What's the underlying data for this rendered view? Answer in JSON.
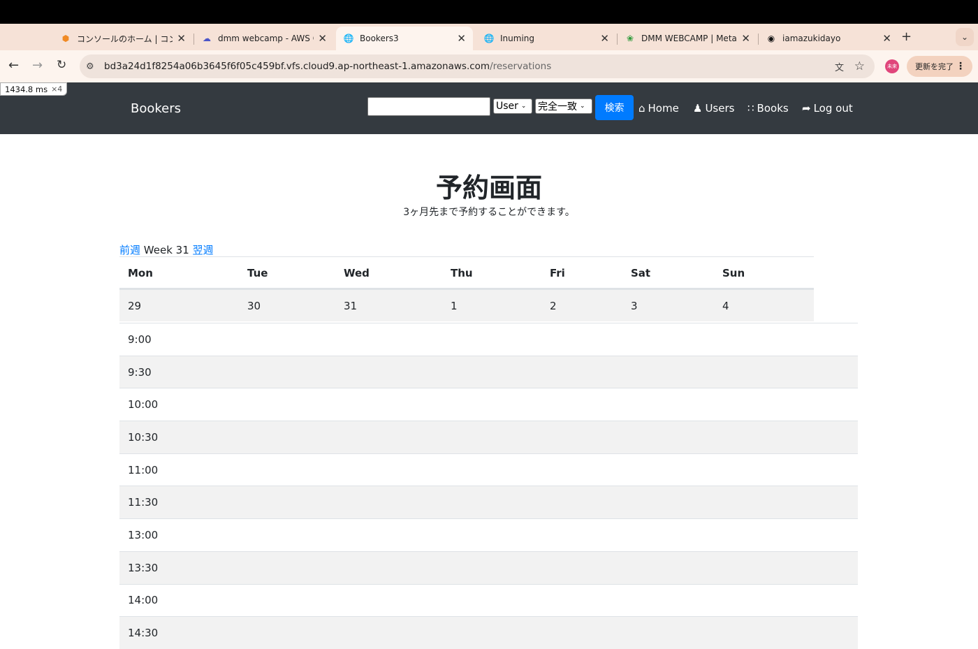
{
  "browser": {
    "tabs": [
      {
        "title": "コンソールのホーム | コンソ",
        "favicon": "aws-cube-icon",
        "color": "#f08a24"
      },
      {
        "title": "dmm webcamp - AWS Cl",
        "favicon": "cloud9-icon",
        "color": "#4b55c8"
      },
      {
        "title": "Bookers3",
        "favicon": "globe-icon",
        "color": "#444444"
      },
      {
        "title": "Inuming",
        "favicon": "globe-icon",
        "color": "#444444"
      },
      {
        "title": "DMM WEBCAMP | MetaL",
        "favicon": "leaf-icon",
        "color": "#2e9a3a"
      },
      {
        "title": "iamazukidayo",
        "favicon": "github-icon",
        "color": "#111111"
      }
    ],
    "url_host": "bd3a24d1f8254a06b3645f6f05c459bf.vfs.cloud9.ap-northeast-1.amazonaws.com",
    "url_path": "/reservations",
    "profile_label": "未来",
    "update_label": "更新を完了"
  },
  "perf": {
    "time": "1434.8 ms",
    "multiplier": "×4"
  },
  "navbar": {
    "brand": "Bookers",
    "search_value": "",
    "model_select": "User",
    "match_select": "完全一致",
    "search_button": "検索",
    "links": {
      "home": "Home",
      "users": "Users",
      "books": "Books",
      "logout": "Log out"
    }
  },
  "page": {
    "title": "予約画面",
    "subtitle": "3ヶ月先まで予約することができます。",
    "prev_week": "前週",
    "week_label": "Week 31",
    "next_week": "翌週"
  },
  "calendar": {
    "days": [
      "Mon",
      "Tue",
      "Wed",
      "Thu",
      "Fri",
      "Sat",
      "Sun"
    ],
    "dates": [
      "29",
      "30",
      "31",
      "1",
      "2",
      "3",
      "4"
    ],
    "times": [
      "9:00",
      "9:30",
      "10:00",
      "10:30",
      "11:00",
      "11:30",
      "13:00",
      "13:30",
      "14:00",
      "14:30"
    ]
  }
}
